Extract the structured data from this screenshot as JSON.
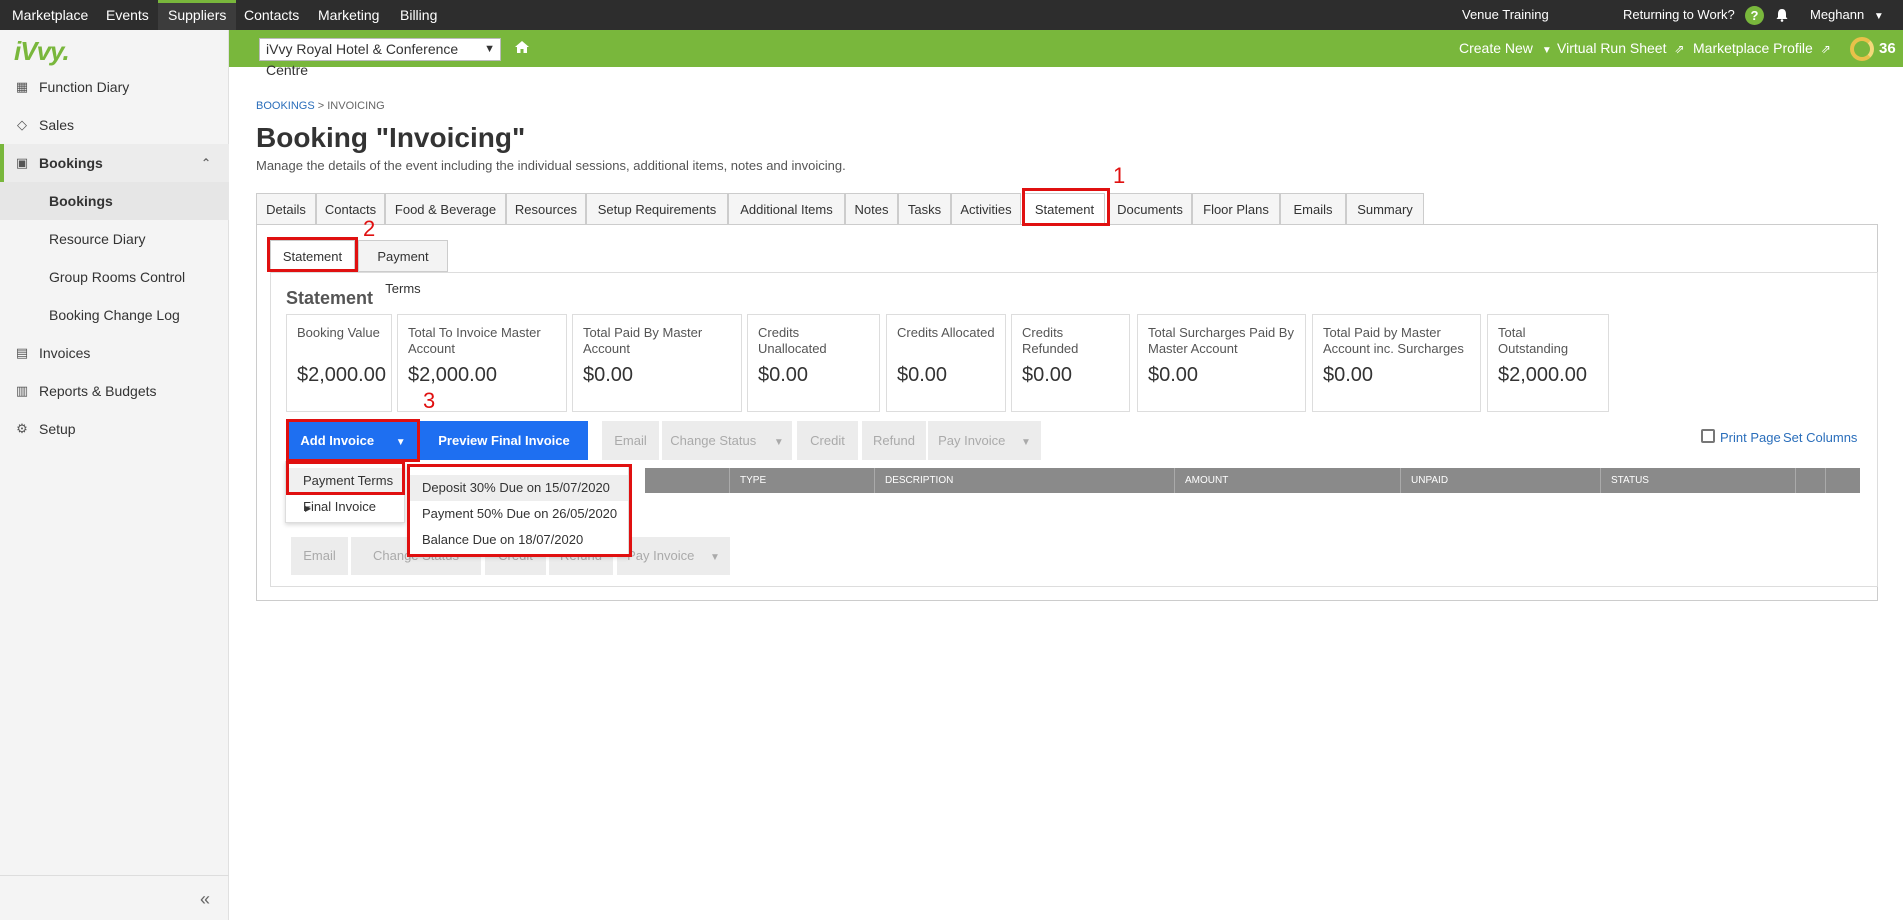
{
  "topnav": {
    "items": [
      "Marketplace",
      "Events",
      "Suppliers",
      "Contacts",
      "Marketing",
      "Billing"
    ],
    "active": "Suppliers",
    "venue_training": "Venue Training",
    "returning": "Returning to Work?",
    "help_glyph": "?",
    "user": "Meghann"
  },
  "greenbar": {
    "venue": "iVvy Royal Hotel & Conference Centre",
    "create_new": "Create New",
    "run_sheet": "Virtual Run Sheet",
    "marketplace_profile": "Marketplace Profile",
    "score": "36"
  },
  "sidebar": {
    "logo": "iVvy.",
    "items": [
      {
        "label": "Function Diary",
        "icon": "calendar-icon"
      },
      {
        "label": "Sales",
        "icon": "sales-icon"
      },
      {
        "label": "Bookings",
        "icon": "briefcase-icon"
      },
      {
        "label": "Bookings",
        "icon": ""
      },
      {
        "label": "Resource Diary",
        "icon": ""
      },
      {
        "label": "Group Rooms Control",
        "icon": ""
      },
      {
        "label": "Booking Change Log",
        "icon": ""
      },
      {
        "label": "Invoices",
        "icon": "invoice-icon"
      },
      {
        "label": "Reports & Budgets",
        "icon": "chart-icon"
      },
      {
        "label": "Setup",
        "icon": "gear-icon"
      }
    ],
    "collapse_glyph": "«"
  },
  "breadcrumb": {
    "root": "BOOKINGS",
    "sep": " > ",
    "current": "INVOICING"
  },
  "page": {
    "title": "Booking \"Invoicing\"",
    "subtitle": "Manage the details of the event including the individual sessions, additional items, notes and invoicing."
  },
  "tabs": [
    "Details",
    "Contacts",
    "Food & Beverage",
    "Resources",
    "Setup Requirements",
    "Additional Items",
    "Notes",
    "Tasks",
    "Activities",
    "Statement",
    "Documents",
    "Floor Plans",
    "Emails",
    "Summary"
  ],
  "subtabs": [
    "Statement",
    "Payment Terms"
  ],
  "statement": {
    "heading": "Statement",
    "cards": [
      {
        "label": "Booking Value",
        "value": "$2,000.00"
      },
      {
        "label": "Total To Invoice Master Account",
        "value": "$2,000.00"
      },
      {
        "label": "Total Paid By Master Account",
        "value": "$0.00"
      },
      {
        "label": "Credits Unallocated",
        "value": "$0.00"
      },
      {
        "label": "Credits Allocated",
        "value": "$0.00"
      },
      {
        "label": "Credits Refunded",
        "value": "$0.00"
      },
      {
        "label": "Total Surcharges Paid By Master Account",
        "value": "$0.00"
      },
      {
        "label": "Total Paid by Master Account inc. Surcharges",
        "value": "$0.00"
      },
      {
        "label": "Total Outstanding",
        "value": "$2,000.00"
      }
    ]
  },
  "actions": {
    "add_invoice": "Add Invoice",
    "preview_final": "Preview Final Invoice",
    "email": "Email",
    "change_status": "Change Status",
    "credit": "Credit",
    "refund": "Refund",
    "pay_invoice": "Pay Invoice",
    "print_page": "Print Page",
    "set_columns": "Set Columns"
  },
  "table_columns": [
    "TYPE",
    "DESCRIPTION",
    "AMOUNT",
    "UNPAID",
    "STATUS"
  ],
  "add_menu": {
    "items": [
      "Payment Terms",
      "Final Invoice"
    ],
    "submenu": [
      "Deposit 30% Due on 15/07/2020",
      "Payment 50% Due on 26/05/2020",
      "Balance Due on 18/07/2020"
    ]
  },
  "annotations": [
    "1",
    "2",
    "3"
  ]
}
